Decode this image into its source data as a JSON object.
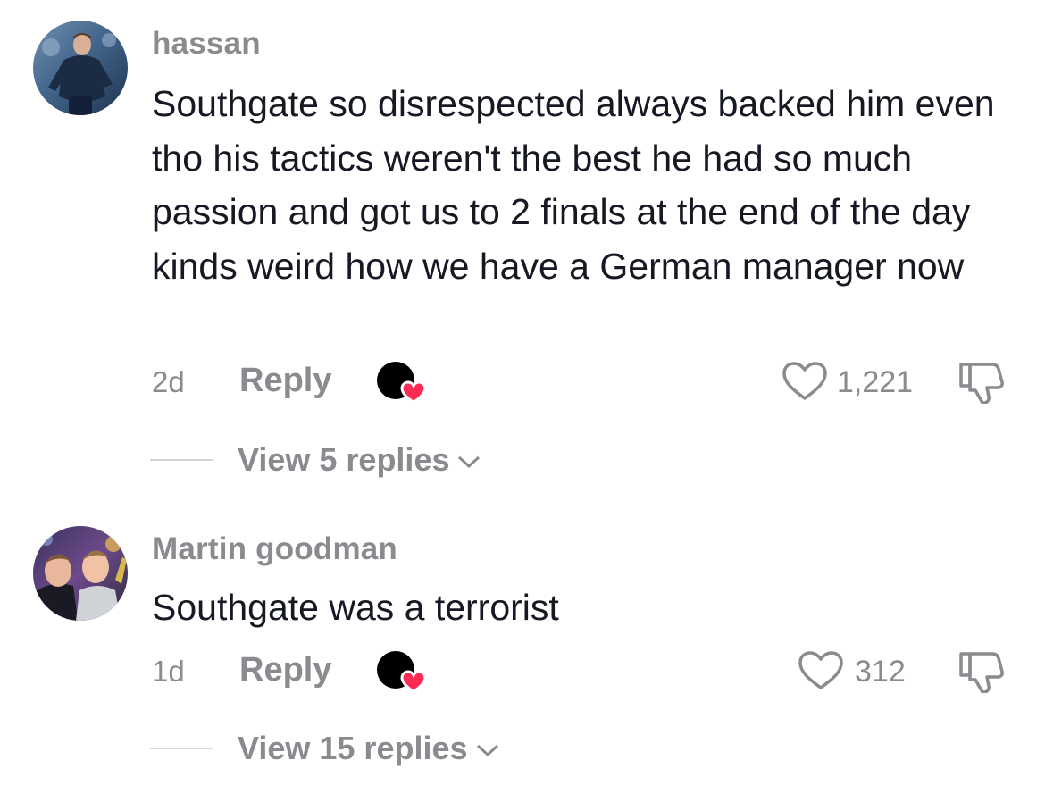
{
  "comments": [
    {
      "username": "hassan",
      "text": "Southgate so disrespected always backed him even tho his tactics weren't the best he had so much passion and got us to 2 finals at the end of the day kinds weird how we have a German manager now",
      "age": "2d",
      "reply_label": "Reply",
      "likes": "1,221",
      "view_replies": "View 5 replies"
    },
    {
      "username": "Martin goodman",
      "text": "Southgate was a terrorist",
      "age": "1d",
      "reply_label": "Reply",
      "likes": "312",
      "view_replies": "View 15 replies"
    }
  ],
  "icons": {
    "like": "heart-outline-icon",
    "dislike": "thumbs-down-icon",
    "creator_liked": "creator-liked-heart-icon",
    "expand": "chevron-down-icon"
  },
  "colors": {
    "text": "#161823",
    "muted": "#8a8a8f",
    "heart_badge": "#fe2c55"
  }
}
